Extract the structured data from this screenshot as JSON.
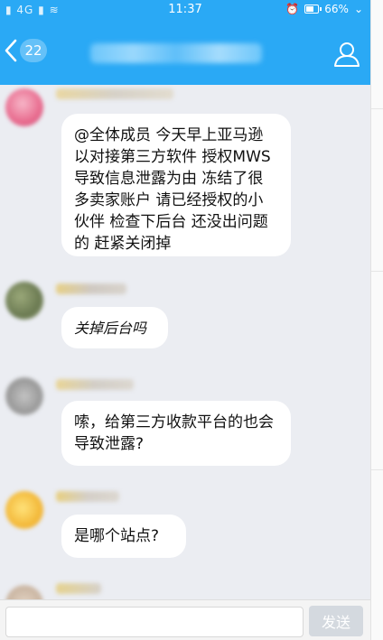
{
  "status_bar": {
    "signal_text": "▮ 4G ▮ ≋",
    "time": "11:37",
    "battery_percent": "66%"
  },
  "header": {
    "back_badge": "22",
    "back_icon": "chevron-left-icon",
    "profile_icon": "person-icon"
  },
  "messages": [
    {
      "text": "@全体成员 今天早上亚马逊以对接第三方软件 授权MWS 导致信息泄露为由 冻结了很多卖家账户 请已经授权的小伙伴 检查下后台 还没出问题的 赶紧关闭掉"
    },
    {
      "text": "关掉后台吗"
    },
    {
      "text": "嗦，给第三方收款平台的也会导致泄露?"
    },
    {
      "text": "是哪个站点?"
    }
  ],
  "input_bar": {
    "send_label": "发送"
  },
  "colors": {
    "accent": "#2aa9f5",
    "chat_background": "#ebedf2",
    "bubble": "#ffffff"
  }
}
